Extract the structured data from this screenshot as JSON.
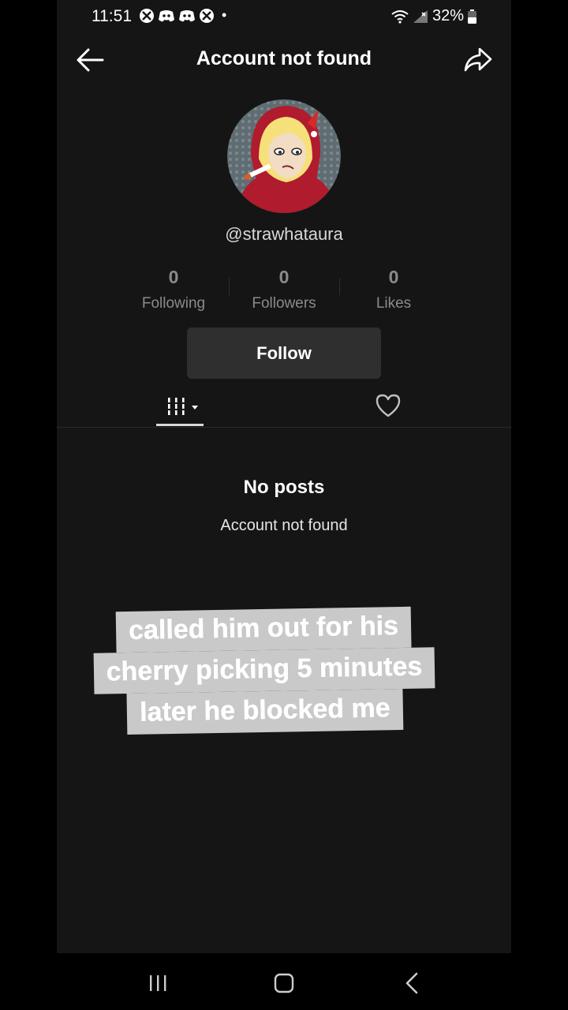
{
  "status_bar": {
    "time": "11:51",
    "battery_percent": "32%"
  },
  "header": {
    "title": "Account not found",
    "back_icon": "arrow-left-icon",
    "share_icon": "share-arrow-icon"
  },
  "profile": {
    "username": "@strawhataura",
    "stats": [
      {
        "count": "0",
        "label": "Following"
      },
      {
        "count": "0",
        "label": "Followers"
      },
      {
        "count": "0",
        "label": "Likes"
      }
    ],
    "follow_label": "Follow"
  },
  "tabs": {
    "videos_icon": "grid-icon",
    "liked_icon": "heart-icon"
  },
  "empty_state": {
    "title": "No posts",
    "subtitle": "Account not found"
  },
  "caption": {
    "lines": [
      "called him out for his",
      "cherry picking 5 minutes",
      "later he blocked me"
    ]
  },
  "colors": {
    "background": "#151515",
    "follow_button": "#2f2f2f",
    "caption_bg": "#c9c9c9"
  }
}
